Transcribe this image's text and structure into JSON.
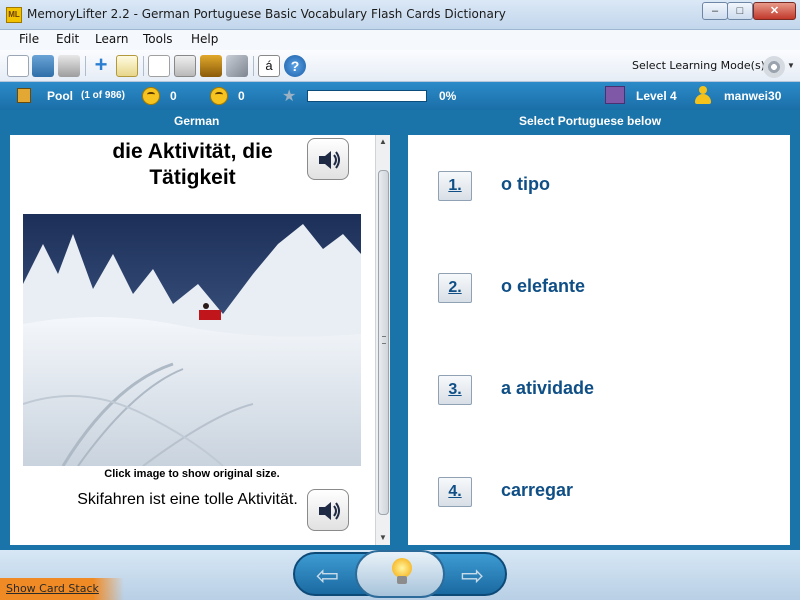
{
  "window": {
    "app_icon_text": "ML",
    "title": "MemoryLifter 2.2 - German Portuguese Basic Vocabulary Flash Cards Dictionary",
    "controls": {
      "minimize": "–",
      "maximize": "□",
      "close": "✕"
    }
  },
  "menu": {
    "file": "File",
    "edit": "Edit",
    "learn": "Learn",
    "tools": "Tools",
    "help": "Help"
  },
  "toolbar": {
    "icons": [
      "new-file-icon",
      "open-folder-icon",
      "print-icon",
      "add-card-icon",
      "edit-card-icon",
      "presentation-icon",
      "record-icon",
      "card-box-icon",
      "tools-icon",
      "special-character-icon",
      "help-icon"
    ],
    "special_char": "á",
    "help_glyph": "?",
    "learning_mode_label": "Select Learning Mode(s)"
  },
  "status": {
    "pool_label": "Pool",
    "pool_count": "(1 of 986)",
    "correct_count": "0",
    "wrong_count": "0",
    "progress_percent": "0%",
    "progress_fraction": 0,
    "level": "Level 4",
    "username": "manwei30"
  },
  "question": {
    "column_header": "German",
    "word": "die Aktivität, die Tätigkeit",
    "image_caption": "Click image to show original size.",
    "example_sentence": "Skifahren ist eine tolle Aktivität."
  },
  "answers": {
    "column_header": "Select Portuguese below",
    "options": [
      {
        "number": "1.",
        "text": "o tipo"
      },
      {
        "number": "2.",
        "text": "o elefante"
      },
      {
        "number": "3.",
        "text": "a atividade"
      },
      {
        "number": "4.",
        "text": "carregar"
      }
    ]
  },
  "bottom": {
    "show_card_stack": "Show Card Stack",
    "back_arrow": "⇦",
    "forward_arrow": "⇨"
  },
  "colors": {
    "accent_blue": "#1a73a9",
    "answer_text": "#0f4f86",
    "card_stack_tab": "#f08a24"
  }
}
